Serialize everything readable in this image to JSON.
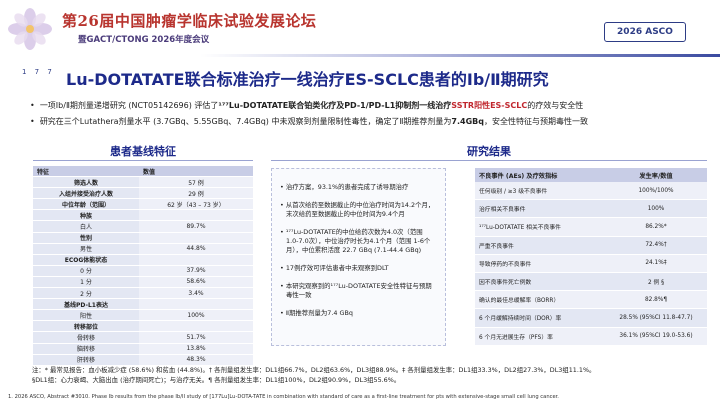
{
  "header": {
    "conference_title": "第26届中国肿瘤学临床试验发展论坛",
    "conference_subtitle": "暨GACT/CTONG 2026年度会议",
    "badge": "2026 ASCO",
    "logo_icon": "flower-logo-icon"
  },
  "slide": {
    "ref_marks": "1 7 7",
    "title": "Lu-DOTATATE联合标准治疗一线治疗ES-SCLC患者的Ⅰb/Ⅱ期研究"
  },
  "bullets": [
    {
      "pre": "一项Ⅰb/Ⅱ期剂量递增研究 (NCT05142696) 评估了",
      "bold": "¹⁷⁷Lu-DOTATATE联合铂类化疗及PD-1/PD-L1抑制剂一线治疗",
      "hl": "SSTR阳性ES-SCLC",
      "post": "的疗效与安全性"
    },
    {
      "pre": "研究在三个Lutathera剂量水平 (3.7GBq、5.55GBq、7.4GBq) 中未观察到剂量限制性毒性，确定了Ⅱ期推荐剂量为",
      "bold": "7.4GBq",
      "post": "，安全性特征与预期毒性一致"
    }
  ],
  "left_panel": {
    "heading": "患者基线特征",
    "header": [
      "特征",
      "数值"
    ],
    "rows": [
      [
        "筛选人数",
        "57 例"
      ],
      [
        "入组并接受治疗人数",
        "29 例"
      ],
      [
        "中位年龄（范围）",
        "62 岁（43 – 73 岁）"
      ],
      [
        "种族",
        ""
      ],
      [
        "白人",
        "89.7%"
      ],
      [
        "性别",
        ""
      ],
      [
        "男性",
        "44.8%"
      ],
      [
        "ECOG体能状态",
        ""
      ],
      [
        "0 分",
        "37.9%"
      ],
      [
        "1 分",
        "58.6%"
      ],
      [
        "2 分",
        "3.4%"
      ],
      [
        "基线PD-L1表达",
        ""
      ],
      [
        "阳性",
        "100%"
      ],
      [
        "转移部位",
        ""
      ],
      [
        "骨转移",
        "51.7%"
      ],
      [
        "脑转移",
        "13.8%"
      ],
      [
        "肝转移",
        "48.3%"
      ]
    ]
  },
  "right_panel": {
    "heading": "研究结果",
    "mid_items": [
      "治疗方案，93.1%的患者完成了诱导期治疗",
      "从首次给药至数据截止的中位治疗时间为14.2个月，末次给药至数据截止的中位时间为9.4个月",
      "¹⁷⁷Lu-DOTATATE的中位给药次数为4.0次（范围 1.0-7.0次），中位治疗时长为4.1个月（范围 1-6个月），中位累积活度 22.7 GBq (7.1-44.4 GBq)",
      "17例疗效可评估患者中未观察到DLT",
      "本研究观察到的¹⁷⁷Lu-DOTATATE安全性特征与预期毒性一致",
      "Ⅱ期推荐剂量为7.4 GBq"
    ],
    "table_header": [
      "不良事件 (AEs) 及疗效指标",
      "发生率/数值"
    ],
    "table_rows": [
      [
        "任何级别 / ≥3 级不良事件",
        "100%/100%"
      ],
      [
        "治疗相关不良事件",
        "100%"
      ],
      [
        "¹⁷⁷Lu-DOTATATE 相关不良事件",
        "86.2%*"
      ],
      [
        "严重不良事件",
        "72.4%†"
      ],
      [
        "导致停药的不良事件",
        "24.1%‡"
      ],
      [
        "因不良事件死亡例数",
        "2 例 §"
      ],
      [
        "确认的最佳总缓解率（BORR）",
        "82.8%¶"
      ],
      [
        "6 个月缓解持续时间（DOR）率",
        "28.5% (95%CI 11.8-47.7)"
      ],
      [
        "6 个月无进展生存（PFS）率",
        "36.1% (95%CI 19.0-53.6)"
      ]
    ]
  },
  "notes": {
    "line1": "注：* 最常见报告：血小板减少症 (58.6%) 和贫血 (44.8%)。† 各剂量组发生率：DL1组66.7%，DL2组63.6%，DL3组88.9%。‡ 各剂量组发生率：DL1组33.3%，DL2组27.3%，DL3组11.1%。",
    "line2": "§DL1组：心力衰竭、大脑出血 (治疗期间死亡)；与治疗无关。¶ 各剂量组发生率：DL1组100%，DL2组90.9%，DL3组55.6%。"
  },
  "footer": {
    "reference": "1.  2026 ASCO, Abstract #3010. Phase Ib results from the phase Ib/II study of [177Lu]Lu-DOTA-TATE in combination with standard of care as a first-line treatment for pts with extensive-stage small cell lung cancer."
  },
  "colors": {
    "title_blue": "#1d2a8a",
    "highlight_red": "#c0262d",
    "conference_red": "#b8342e",
    "table_header": "#c8cde6"
  }
}
